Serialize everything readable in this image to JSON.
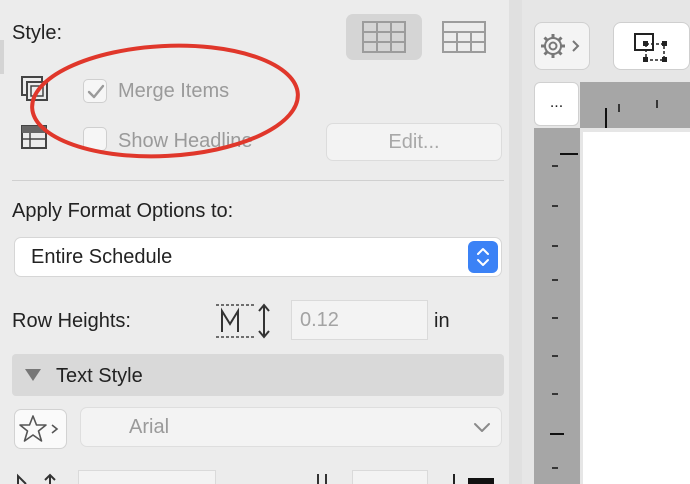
{
  "style": {
    "label": "Style:",
    "merge_items_label": "Merge Items",
    "merge_items_checked": true,
    "show_headline_label": "Show Headline",
    "show_headline_checked": false,
    "edit_button_label": "Edit..."
  },
  "apply_format": {
    "label": "Apply Format Options to:",
    "selected": "Entire Schedule"
  },
  "row_heights": {
    "label": "Row Heights:",
    "value": "0.12",
    "unit": "in"
  },
  "text_style": {
    "section_label": "Text Style",
    "font_name": "Arial"
  },
  "right_panel": {
    "more_button_label": "..."
  },
  "colors": {
    "accent": "#3b82f6",
    "annotation": "#e0372b"
  },
  "icons": [
    "table-grid-icon",
    "table-plain-icon",
    "merge-items-icon",
    "show-headline-icon",
    "row-height-icon",
    "star-favorite-icon",
    "chevron-down-icon",
    "gear-icon",
    "selection-icon",
    "select-stepper-icon",
    "disclosure-triangle-icon"
  ]
}
